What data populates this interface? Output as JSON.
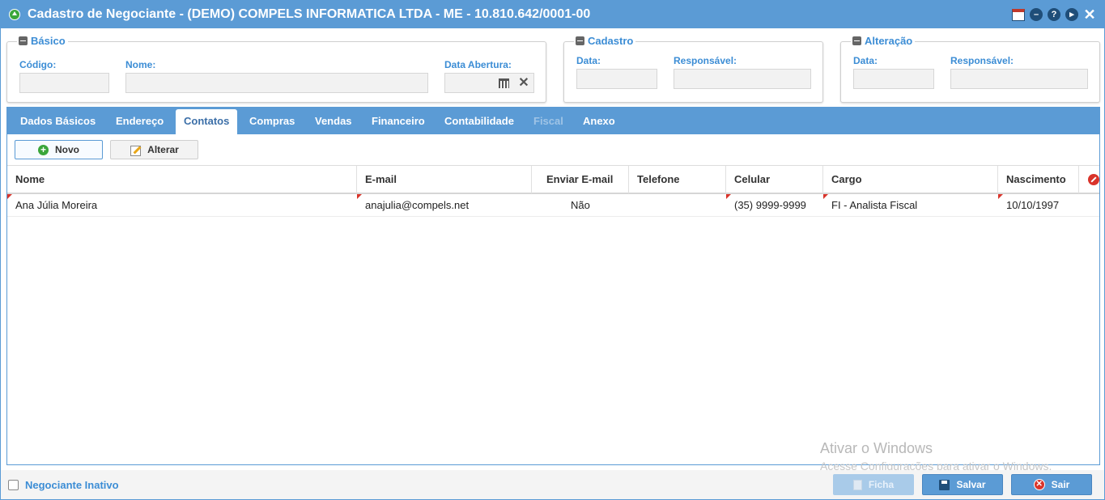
{
  "window": {
    "title": "Cadastro de Negociante - (DEMO) COMPELS INFORMATICA LTDA - ME - 10.810.642/0001-00",
    "title_icons": [
      "calendar-icon",
      "minimize-icon",
      "help-icon",
      "next-icon",
      "close-icon"
    ],
    "help_glyph": "?",
    "close_glyph": "✕"
  },
  "basico": {
    "legend": "Básico",
    "codigo_label": "Código:",
    "codigo_value": "",
    "nome_label": "Nome:",
    "nome_value": "",
    "data_abertura_label": "Data Abertura:",
    "data_abertura_value": "",
    "clear_glyph": "✕"
  },
  "cadastro": {
    "legend": "Cadastro",
    "data_label": "Data:",
    "data_value": "",
    "responsavel_label": "Responsável:",
    "responsavel_value": ""
  },
  "alteracao": {
    "legend": "Alteração",
    "data_label": "Data:",
    "data_value": "",
    "responsavel_label": "Responsável:",
    "responsavel_value": ""
  },
  "tabs": [
    {
      "label": "Dados Básicos"
    },
    {
      "label": "Endereço"
    },
    {
      "label": "Contatos"
    },
    {
      "label": "Compras"
    },
    {
      "label": "Vendas"
    },
    {
      "label": "Financeiro"
    },
    {
      "label": "Contabilidade"
    },
    {
      "label": "Fiscal"
    },
    {
      "label": "Anexo"
    }
  ],
  "active_tab": "Contatos",
  "disabled_tab": "Fiscal",
  "toolbar": {
    "novo_label": "Novo",
    "novo_glyph": "+",
    "alterar_label": "Alterar"
  },
  "grid": {
    "columns": [
      "Nome",
      "E-mail",
      "Enviar E-mail",
      "Telefone",
      "Celular",
      "Cargo",
      "Nascimento"
    ],
    "rows": [
      {
        "nome": "Ana Júlia Moreira",
        "email": "anajulia@compels.net",
        "enviar_email": "Não",
        "telefone": "",
        "celular": "(35) 9999-9999",
        "cargo": "FI - Analista Fiscal",
        "nascimento": "10/10/1997"
      }
    ]
  },
  "footer": {
    "inativo_label": "Negociante Inativo",
    "inativo_checked": false,
    "ficha_label": "Ficha",
    "salvar_label": "Salvar",
    "sair_label": "Sair",
    "sair_glyph": "✕"
  },
  "watermark": {
    "line1": "Ativar o Windows",
    "line2": "Acesse Configurações para ativar o Windows."
  },
  "colors": {
    "accent": "#5b9bd5",
    "label": "#3c8dd5",
    "danger": "#d9342b",
    "success": "#3aa63a"
  }
}
